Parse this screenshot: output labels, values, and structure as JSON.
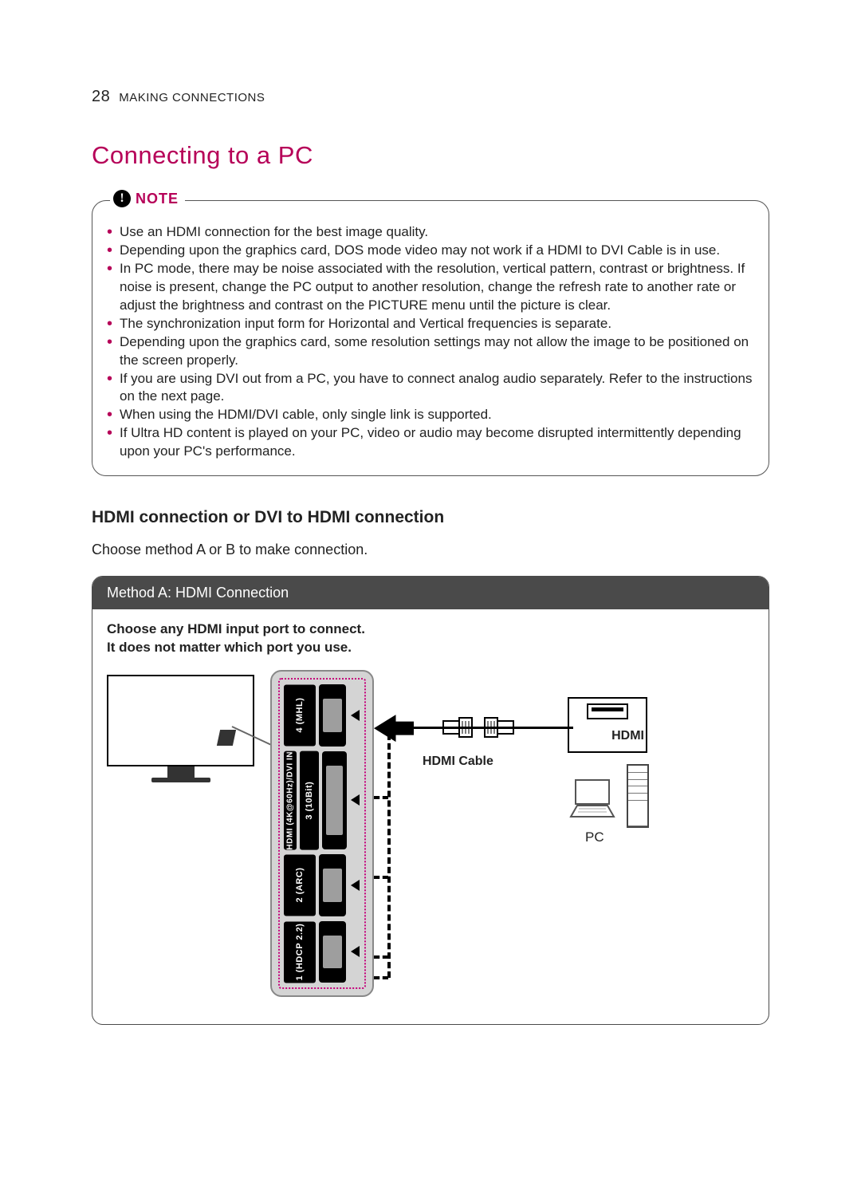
{
  "header": {
    "page_number": "28",
    "section_title": "MAKING CONNECTIONS"
  },
  "title": "Connecting to a PC",
  "note": {
    "label": "NOTE",
    "icon_glyph": "!",
    "items": [
      "Use an HDMI connection for the best image quality.",
      "Depending upon the graphics card, DOS mode video may not work if a HDMI to DVI Cable is in use.",
      "In PC mode, there may be noise associated with the resolution, vertical pattern, contrast or brightness. If noise is present, change the PC output to another resolution, change the refresh rate to another rate or adjust the brightness and contrast on the PICTURE menu until the picture is clear.",
      "The synchronization input form for Horizontal and Vertical frequencies is separate.",
      "Depending upon the graphics card, some resolution settings may not allow the image to be positioned on the screen properly.",
      "If you are using DVI out from a PC, you have to connect analog audio separately. Refer to the instructions on the next page.",
      "When using the HDMI/DVI cable, only single link is supported.",
      "If Ultra HD content is played on your PC, video or audio may become disrupted intermittently depending upon your PC's performance."
    ]
  },
  "subhead": "HDMI connection or DVI to HDMI connection",
  "intro": "Choose method A or B to make connection.",
  "method_a": {
    "header": "Method A: HDMI Connection",
    "desc_line1": "Choose any HDMI input port to connect.",
    "desc_line2": "It does not matter which port you use.",
    "panel_strip_label": "HDMI (4K@60Hz)/DVI IN",
    "ports": [
      "4 (MHL)",
      "3 (10Bit)",
      "2 (ARC)",
      "1 (HDCP 2.2)"
    ],
    "cable_label": "HDMI Cable",
    "pc_port_label": "HDMI",
    "pc_label": "PC"
  }
}
